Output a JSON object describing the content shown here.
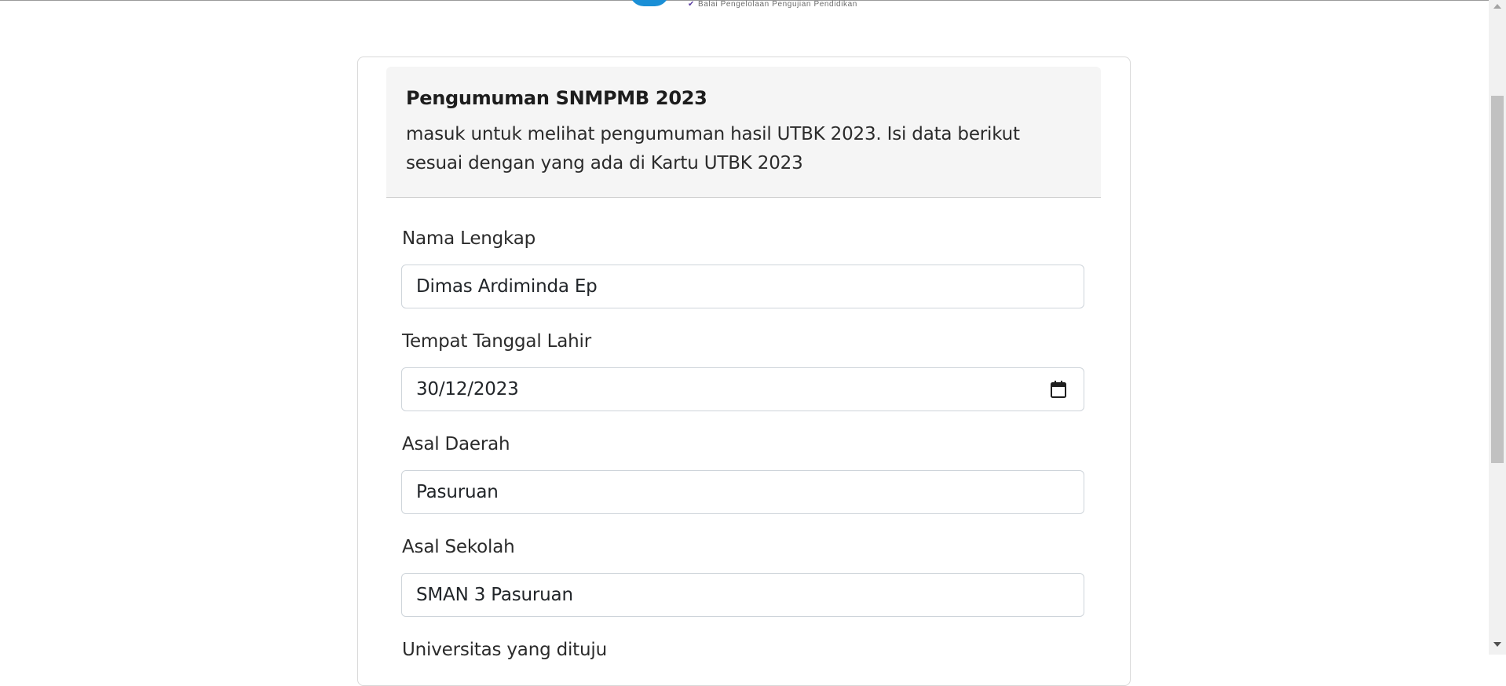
{
  "header": {
    "logo_text": "Balai  Pengelolaan  Pengujian  Pendidikan"
  },
  "card": {
    "title": "Pengumuman SNMPMB 2023",
    "description": "masuk untuk melihat pengumuman hasil UTBK 2023. Isi data berikut sesuai dengan yang ada di Kartu UTBK 2023"
  },
  "form": {
    "nama_label": "Nama Lengkap",
    "nama_value": "Dimas Ardiminda Ep",
    "ttl_label": "Tempat Tanggal Lahir",
    "ttl_value": "30/12/2023",
    "daerah_label": "Asal Daerah",
    "daerah_value": "Pasuruan",
    "sekolah_label": "Asal Sekolah",
    "sekolah_value": "SMAN 3 Pasuruan",
    "universitas_label": "Universitas yang dituju"
  },
  "colors": {
    "accent": "#1a8fd6",
    "header_bg": "#f5f5f5"
  },
  "icons": {
    "calendar": "calendar-icon",
    "check": "check-icon"
  }
}
